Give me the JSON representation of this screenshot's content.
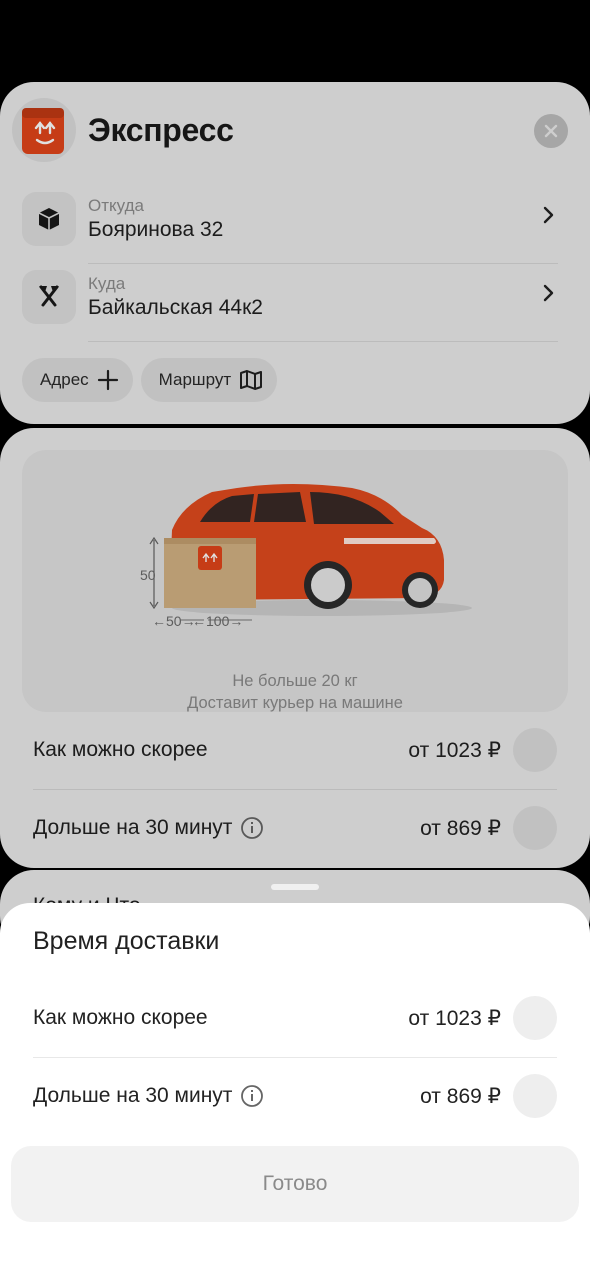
{
  "header": {
    "title": "Экспресс"
  },
  "route": {
    "from": {
      "label": "Откуда",
      "value": "Бояринова 32"
    },
    "to": {
      "label": "Куда",
      "value": "Байкальская 44к2"
    }
  },
  "actions": {
    "address_label": "Адрес",
    "route_label": "Маршрут"
  },
  "tariff": {
    "dims": {
      "height": "50",
      "width": "←50→",
      "length": "←100→"
    },
    "caption1": "Не больше 20 кг",
    "caption2": "Доставит курьер на машине"
  },
  "options": [
    {
      "label": "Как можно скорее",
      "price": "от 1023 ₽"
    },
    {
      "label": "Дольше на 30 минут",
      "price": "от 869 ₽"
    }
  ],
  "peek_text": "Кому и Что",
  "sheet": {
    "title": "Время доставки",
    "options": [
      {
        "label": "Как можно скорее",
        "price": "от 1023 ₽"
      },
      {
        "label": "Дольше на 30 минут",
        "price": "от 869 ₽"
      }
    ],
    "done_label": "Готово"
  },
  "colors": {
    "accent": "#e2451a",
    "background": "#000000",
    "sheet": "#ffffff"
  }
}
